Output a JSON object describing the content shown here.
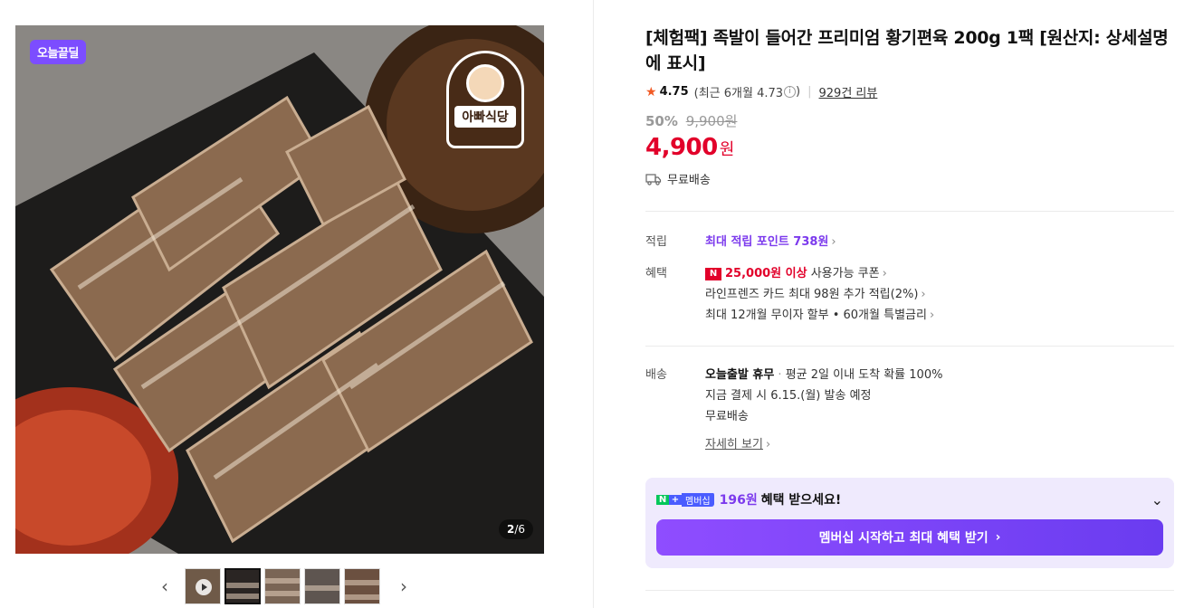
{
  "gallery": {
    "badge": "오늘끝딜",
    "logo_name": "아빠식당",
    "counter_current": "2",
    "counter_total": "/6",
    "prev_label": "‹",
    "next_label": "›"
  },
  "product": {
    "title": "[체험팩] 족발이 들어간 프리미엄 황기편육 200g 1팩 [원산지: 상세설명에 표시]",
    "rating": "4.75",
    "rating_recent": "(최근 6개월 4.73",
    "rating_recent_close": ")",
    "review_count": "929건 리뷰",
    "discount_pct": "50%",
    "original_price": "9,900원",
    "price": "4,900",
    "price_unit": "원",
    "shipping": "무료배송"
  },
  "benefits": {
    "points_label": "적립",
    "points_text": "최대 적립 포인트 738원",
    "benefit_label": "혜택",
    "coupon_amount": "25,000원 이상",
    "coupon_text": " 사용가능 쿠폰",
    "card_text": "라인프렌즈 카드 최대 98원 추가 적립(2%)",
    "installment_text": "최대 12개월 무이자 할부 • 60개월 특별금리"
  },
  "delivery": {
    "label": "배송",
    "status": "오늘출발 휴무",
    "dot": " · ",
    "avg": "평균 2일 이내 도착 확률 100%",
    "schedule": "지금 결제 시 6.15.(월) 발송 예정",
    "fee": "무료배송",
    "details_link": "자세히 보기"
  },
  "membership": {
    "badge_m": "멤버십",
    "amount": "196원",
    "text": "혜택 받으세요!",
    "button": "멤버십 시작하고 최대 혜택 받기"
  }
}
